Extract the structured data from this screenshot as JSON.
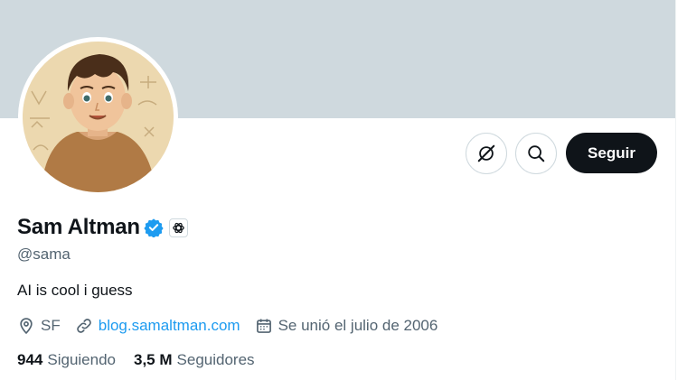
{
  "profile": {
    "name": "Sam Altman",
    "handle": "@sama",
    "bio": "AI is cool i guess",
    "location": "SF",
    "website": "blog.samaltman.com",
    "joined": "Se unió el julio de 2006"
  },
  "actions": {
    "follow_label": "Seguir"
  },
  "stats": {
    "following_count": "944",
    "following_label": "Siguiendo",
    "followers_count": "3,5 M",
    "followers_label": "Seguidores"
  },
  "icons": {
    "grok": "grok-icon",
    "search": "search-icon",
    "verified": "verified-badge-icon",
    "org": "openai-logo-icon",
    "location": "location-pin-icon",
    "link": "link-icon",
    "calendar": "calendar-icon"
  },
  "colors": {
    "banner": "#cfd9de",
    "verified": "#1d9bf0",
    "link": "#1d9bf0",
    "follow_button": "#0f1419",
    "secondary_text": "#536471"
  }
}
